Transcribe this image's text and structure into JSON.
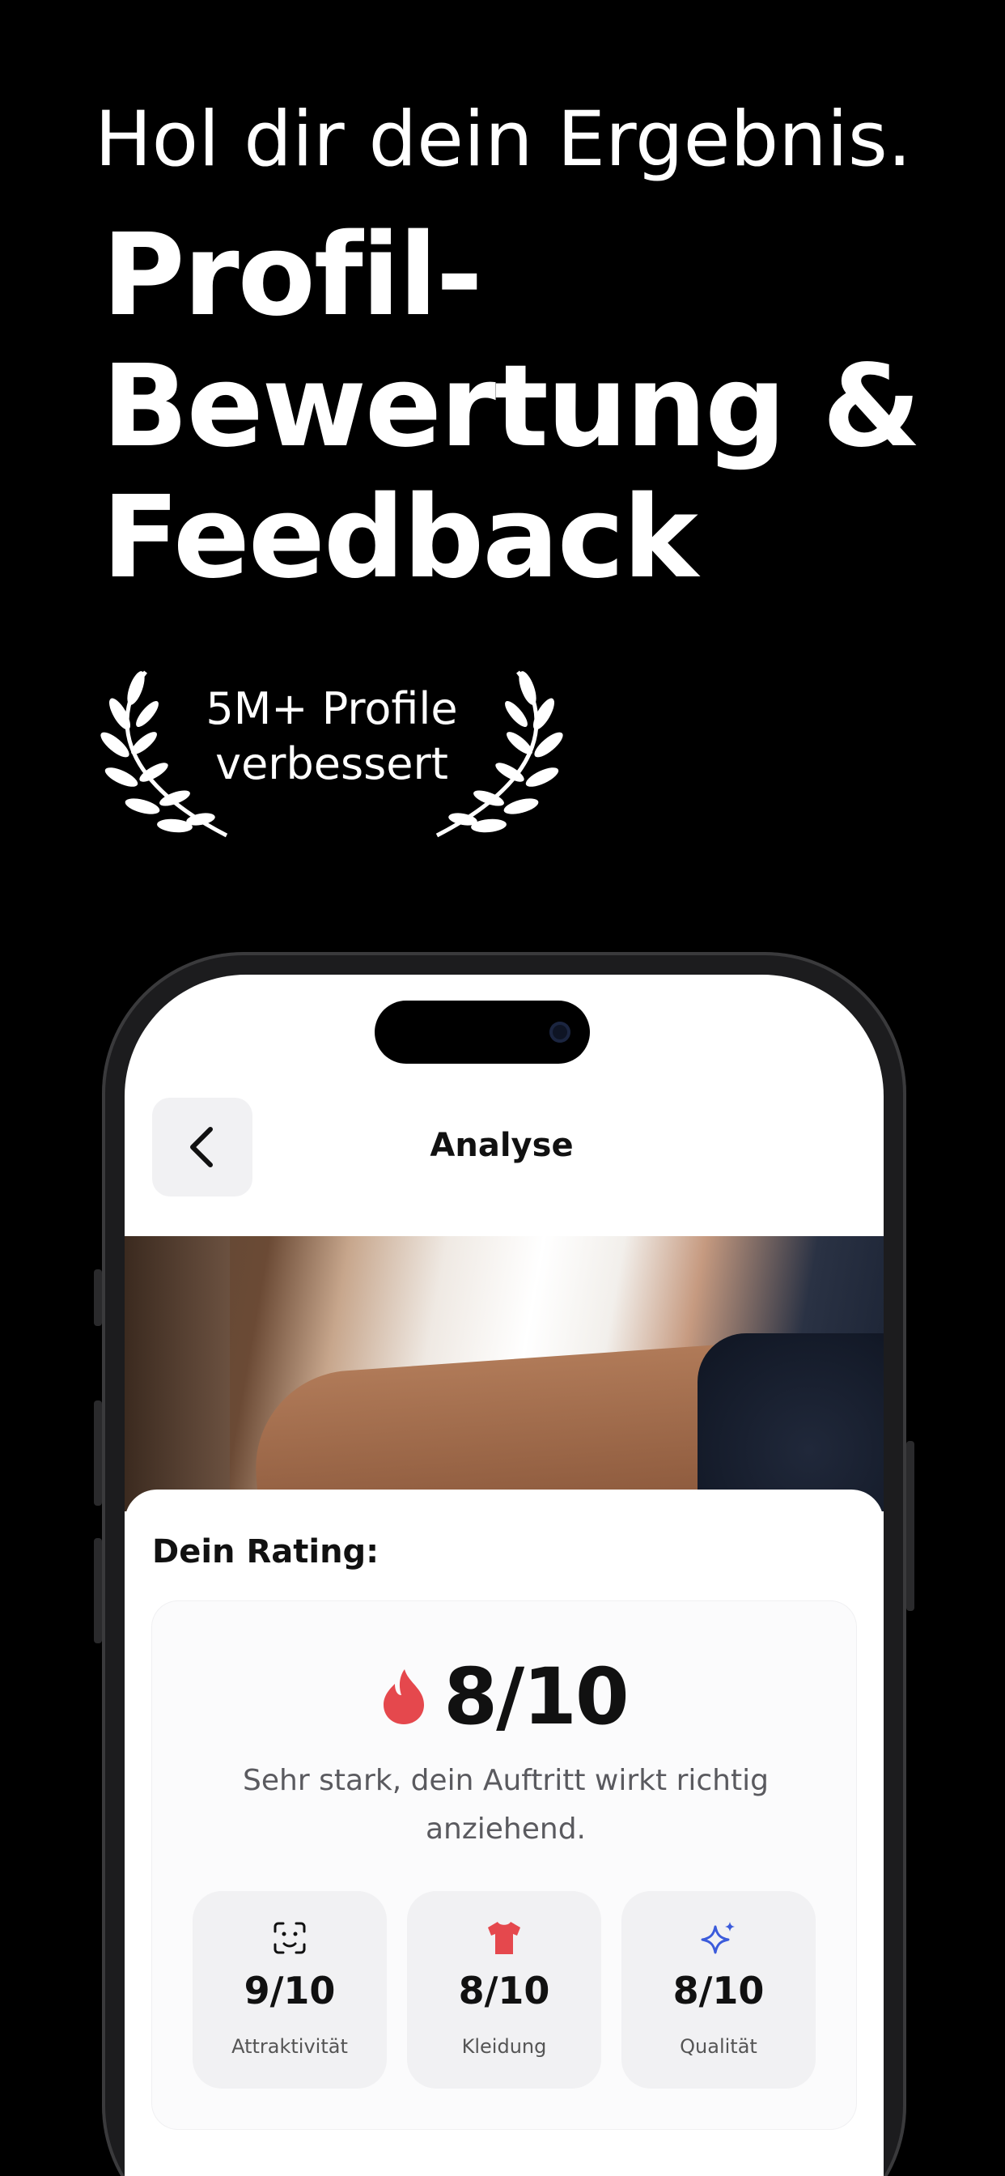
{
  "headline": {
    "small": "Hol dir dein Ergebnis.",
    "big_line1": "Profil-",
    "big_line2": "Bewertung &",
    "big_line3": "Feedback"
  },
  "award": {
    "line1": "5M+ Profile",
    "line2": "verbessert"
  },
  "app": {
    "nav_title": "Analyse",
    "rating_label": "Dein Rating:",
    "score": "8/10",
    "description": "Sehr stark, dein Auftritt wirkt richtig anziehend.",
    "metrics": [
      {
        "value": "9/10",
        "label": "Attraktivität",
        "icon": "face-scan-icon"
      },
      {
        "value": "8/10",
        "label": "Kleidung",
        "icon": "tshirt-icon"
      },
      {
        "value": "8/10",
        "label": "Qualität",
        "icon": "sparkle-icon"
      }
    ]
  },
  "colors": {
    "background": "#000000",
    "flame": "#e5484d",
    "tshirt": "#e5484d",
    "sparkle": "#3b5bdb"
  }
}
